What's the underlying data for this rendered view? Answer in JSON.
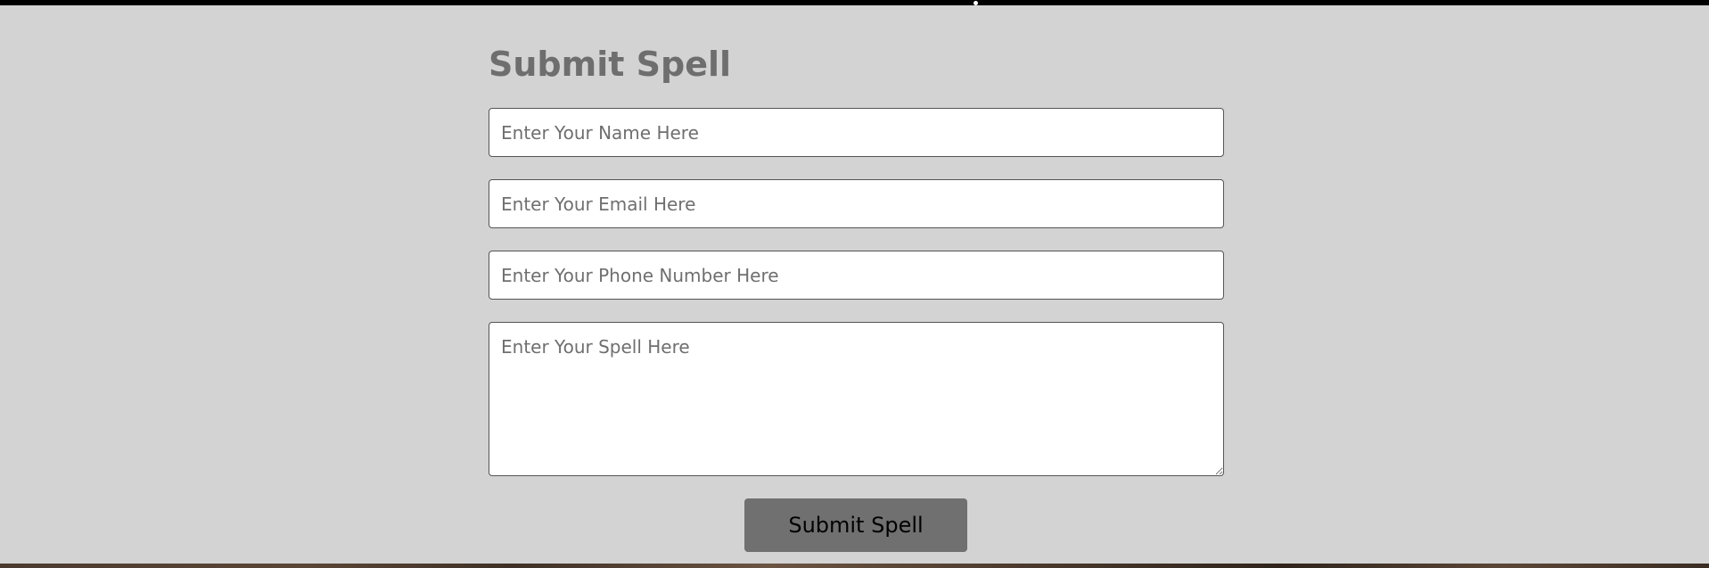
{
  "form": {
    "title": "Submit Spell",
    "name_placeholder": "Enter Your Name Here",
    "email_placeholder": "Enter Your Email Here",
    "phone_placeholder": "Enter Your Phone Number Here",
    "spell_placeholder": "Enter Your Spell Here",
    "submit_label": "Submit Spell"
  },
  "colors": {
    "background": "#d3d3d3",
    "title": "#6e6e6e",
    "button": "#707070"
  }
}
